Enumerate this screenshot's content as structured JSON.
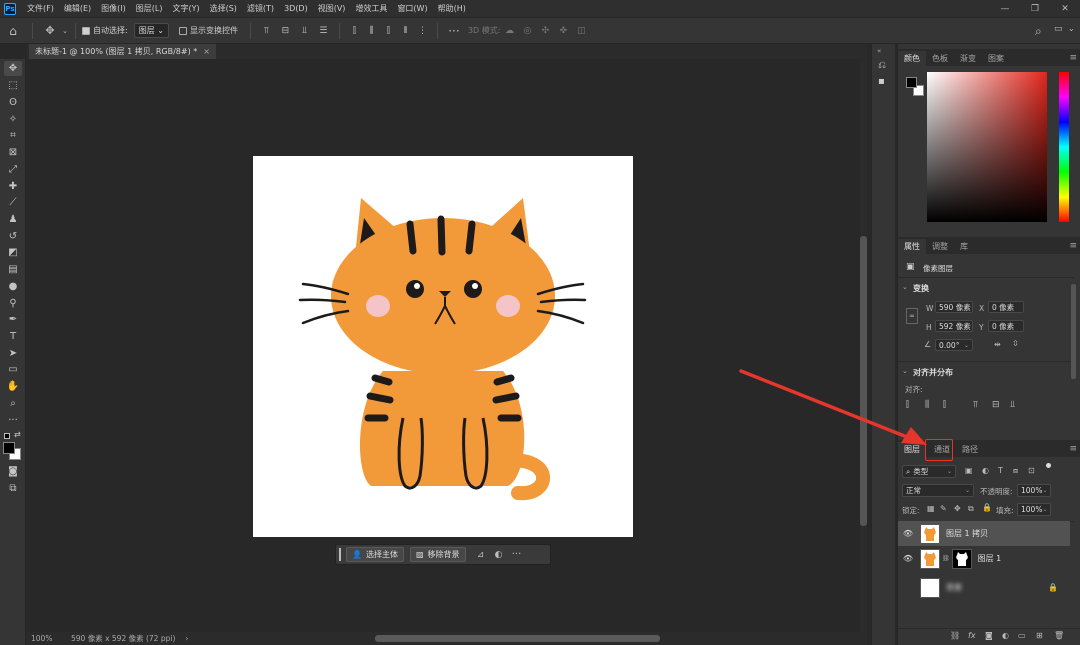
{
  "menubar": {
    "logo": "Ps",
    "items": [
      "文件(F)",
      "编辑(E)",
      "图像(I)",
      "图层(L)",
      "文字(Y)",
      "选择(S)",
      "滤镜(T)",
      "3D(D)",
      "视图(V)",
      "增效工具",
      "窗口(W)",
      "帮助(H)"
    ]
  },
  "options": {
    "auto_select_label": "自动选择:",
    "auto_select_value": "图层",
    "show_transform_label": "显示变换控件",
    "mode3d_label": "3D 模式:"
  },
  "document": {
    "tab_title": "未标题-1 @ 100% (图层 1 拷贝, RGB/8#) *",
    "close": "×"
  },
  "context_bar": {
    "select_subject": "选择主体",
    "remove_bg": "移除背景",
    "more": "···"
  },
  "status": {
    "zoom": "100%",
    "doc_info": "590 像素 x 592 像素 (72 ppi)",
    "arrow": "›"
  },
  "color_panel": {
    "tabs": [
      "颜色",
      "色板",
      "渐变",
      "图案"
    ],
    "fg_color": "#000000",
    "bg_color": "#ffffff",
    "hue_color": "#e1261c"
  },
  "properties_panel": {
    "tabs": [
      "属性",
      "调整",
      "库"
    ],
    "type_label": "像素图层",
    "transform_title": "变换",
    "w_label": "W",
    "w_value": "590 像素",
    "x_label": "X",
    "x_value": "0 像素",
    "h_label": "H",
    "h_value": "592 像素",
    "y_label": "Y",
    "y_value": "0 像素",
    "angle_value": "0.00°",
    "align_title": "对齐并分布",
    "align_label": "对齐:"
  },
  "layers_panel": {
    "tabs": [
      "图层",
      "通道",
      "路径"
    ],
    "filter_kind": "类型",
    "blend_mode": "正常",
    "opacity_label": "不透明度:",
    "opacity_value": "100%",
    "lock_label": "锁定:",
    "fill_label": "填充:",
    "fill_value": "100%",
    "layers": [
      {
        "name": "图层 1 拷贝",
        "selected": true
      },
      {
        "name": "图层 1",
        "selected": false
      },
      {
        "name": "背景",
        "selected": false
      }
    ],
    "highlight_color": "#e4362b"
  }
}
